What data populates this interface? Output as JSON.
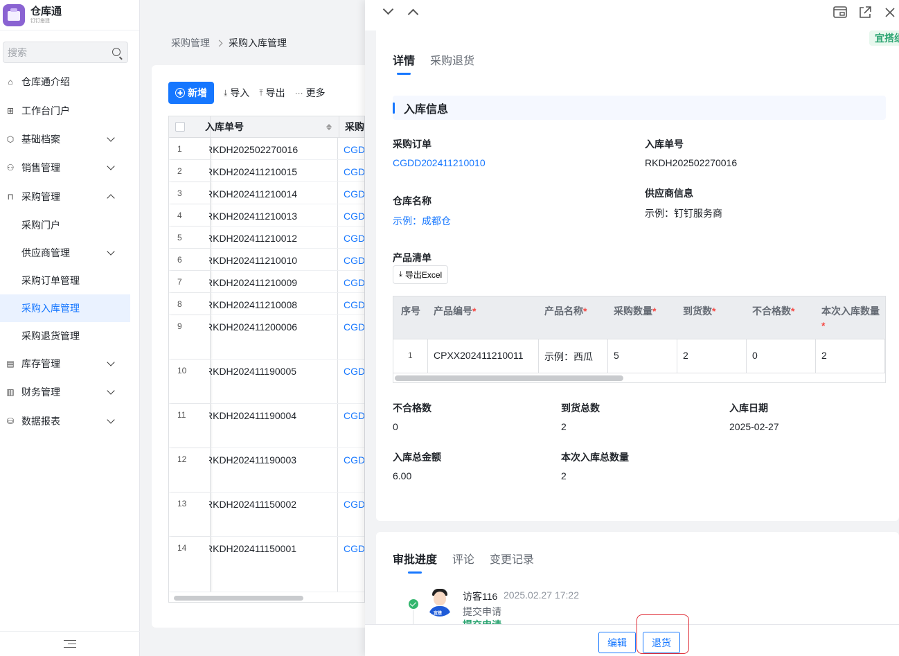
{
  "app": {
    "name": "仓库通",
    "subtitle": "钉钉搭建"
  },
  "sidebar": {
    "search_placeholder": "搜索",
    "items": [
      {
        "label": "仓库通介绍",
        "icon": "home-icon"
      },
      {
        "label": "工作台门户",
        "icon": "grid-icon"
      },
      {
        "label": "基础档案",
        "icon": "cube-icon",
        "chevron": "down"
      },
      {
        "label": "销售管理",
        "icon": "users-icon",
        "chevron": "down"
      },
      {
        "label": "采购管理",
        "icon": "bag-icon",
        "chevron": "up"
      },
      {
        "label": "采购门户",
        "sub": true
      },
      {
        "label": "供应商管理",
        "sub": true,
        "chevron": "down"
      },
      {
        "label": "采购订单管理",
        "sub": true
      },
      {
        "label": "采购入库管理",
        "sub": true,
        "active": true
      },
      {
        "label": "采购退货管理",
        "sub": true
      },
      {
        "label": "库存管理",
        "icon": "warehouse-icon",
        "chevron": "down"
      },
      {
        "label": "财务管理",
        "icon": "chart-icon",
        "chevron": "down"
      },
      {
        "label": "数据报表",
        "icon": "database-icon",
        "chevron": "down"
      }
    ]
  },
  "breadcrumb": {
    "parent": "采购管理",
    "current": "采购入库管理"
  },
  "toolbar": {
    "new": "新增",
    "import": "导入",
    "export": "导出",
    "more": "更多"
  },
  "grid": {
    "col_no": "入库单号",
    "col_po": "采购",
    "rows": [
      {
        "idx": "1",
        "no": "RKDH202502270016",
        "po": "CGD",
        "h": 32
      },
      {
        "idx": "2",
        "no": "RKDH202411210015",
        "po": "CGD",
        "h": 32
      },
      {
        "idx": "3",
        "no": "RKDH202411210014",
        "po": "CGD",
        "h": 32
      },
      {
        "idx": "4",
        "no": "RKDH202411210013",
        "po": "CGD",
        "h": 32
      },
      {
        "idx": "5",
        "no": "RKDH202411210012",
        "po": "CGD",
        "h": 32
      },
      {
        "idx": "6",
        "no": "RKDH202411210010",
        "po": "CGD",
        "h": 32
      },
      {
        "idx": "7",
        "no": "RKDH202411210009",
        "po": "CGD",
        "h": 32
      },
      {
        "idx": "8",
        "no": "RKDH202411210008",
        "po": "CGD",
        "h": 32
      },
      {
        "idx": "9",
        "no": "RKDH202411200006",
        "po": "CGD",
        "h": 64
      },
      {
        "idx": "10",
        "no": "RKDH202411190005",
        "po": "CGD",
        "h": 64
      },
      {
        "idx": "11",
        "no": "RKDH202411190004",
        "po": "CGD",
        "h": 64
      },
      {
        "idx": "12",
        "no": "RKDH202411190003",
        "po": "CGD",
        "h": 64
      },
      {
        "idx": "13",
        "no": "RKDH202411150002",
        "po": "CGD",
        "h": 64
      },
      {
        "idx": "14",
        "no": "RKDH202411150001",
        "po": "CGD",
        "h": 80
      }
    ]
  },
  "drawer": {
    "corner_tag": "宜搭组",
    "tabs": {
      "detail": "详情",
      "return": "采购退货"
    },
    "section_title": "入库信息",
    "fields": {
      "po_label": "采购订单",
      "po_value": "CGDD202411210010",
      "inbound_no_label": "入库单号",
      "inbound_no_value": "RKDH202502270016",
      "warehouse_label": "仓库名称",
      "warehouse_value": "示例：成都仓",
      "supplier_label": "供应商信息",
      "supplier_value": "示例：钉钉服务商",
      "product_list_label": "产品清单",
      "export_excel": "导出Excel",
      "unqualified_label": "不合格数",
      "unqualified_value": "0",
      "arrived_total_label": "到货总数",
      "arrived_total_value": "2",
      "inbound_date_label": "入库日期",
      "inbound_date_value": "2025-02-27",
      "amount_label": "入库总金额",
      "amount_value": "6.00",
      "qty_total_label": "本次入库总数量",
      "qty_total_value": "2"
    },
    "product_table": {
      "headers": {
        "seq": "序号",
        "code": "产品编号",
        "name": "产品名称",
        "purchase_qty": "采购数量",
        "arrived": "到货数",
        "unqualified": "不合格数",
        "inbound_qty": "本次入库数量"
      },
      "required_mark": "*",
      "row": {
        "seq": "1",
        "code": "CPXX202411210011",
        "name": "示例：西瓜",
        "purchase_qty": "5",
        "arrived": "2",
        "unqualified": "0",
        "inbound_qty": "2"
      }
    },
    "approval": {
      "tabs": {
        "progress": "审批进度",
        "comment": "评论",
        "history": "变更记录"
      },
      "user": "访客116",
      "time": "2025.02.27 17:22",
      "action": "提交申请",
      "action2": "提交申请",
      "avatar_badge": "宜搭"
    },
    "footer": {
      "edit": "编辑",
      "return": "退货"
    }
  }
}
